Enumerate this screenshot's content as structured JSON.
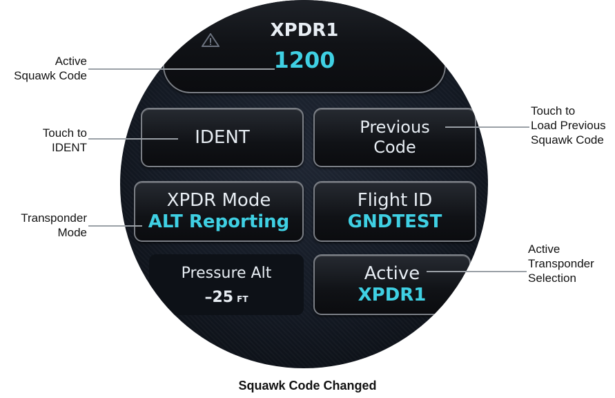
{
  "panel": {
    "xpdr_title": "XPDR1",
    "active_code": "1200",
    "ident_label": "IDENT",
    "previous_code": {
      "line1": "Previous",
      "line2": "Code"
    },
    "xpdr_mode": {
      "label": "XPDR Mode",
      "value": "ALT Reporting"
    },
    "flight_id": {
      "label": "Flight ID",
      "value": "GNDTEST"
    },
    "pressure_alt": {
      "label": "Pressure Alt",
      "value": "–25",
      "unit": "FT"
    },
    "active_selection": {
      "label": "Active",
      "value": "XPDR1"
    }
  },
  "callouts": {
    "active_squawk": {
      "line1": "Active",
      "line2": "Squawk Code"
    },
    "touch_ident": {
      "line1": "Touch to",
      "line2": "IDENT"
    },
    "transponder_mode": {
      "line1": "Transponder",
      "line2": "Mode"
    },
    "load_previous": {
      "line1": "Touch to",
      "line2": "Load Previous",
      "line3": "Squawk Code"
    },
    "active_transponder": {
      "line1": "Active",
      "line2": "Transponder",
      "line3": "Selection"
    }
  },
  "caption": "Squawk Code Changed",
  "colors": {
    "value_cyan": "#3fd0e3",
    "label_white": "#e8eef4",
    "bezel": "#07090d"
  }
}
